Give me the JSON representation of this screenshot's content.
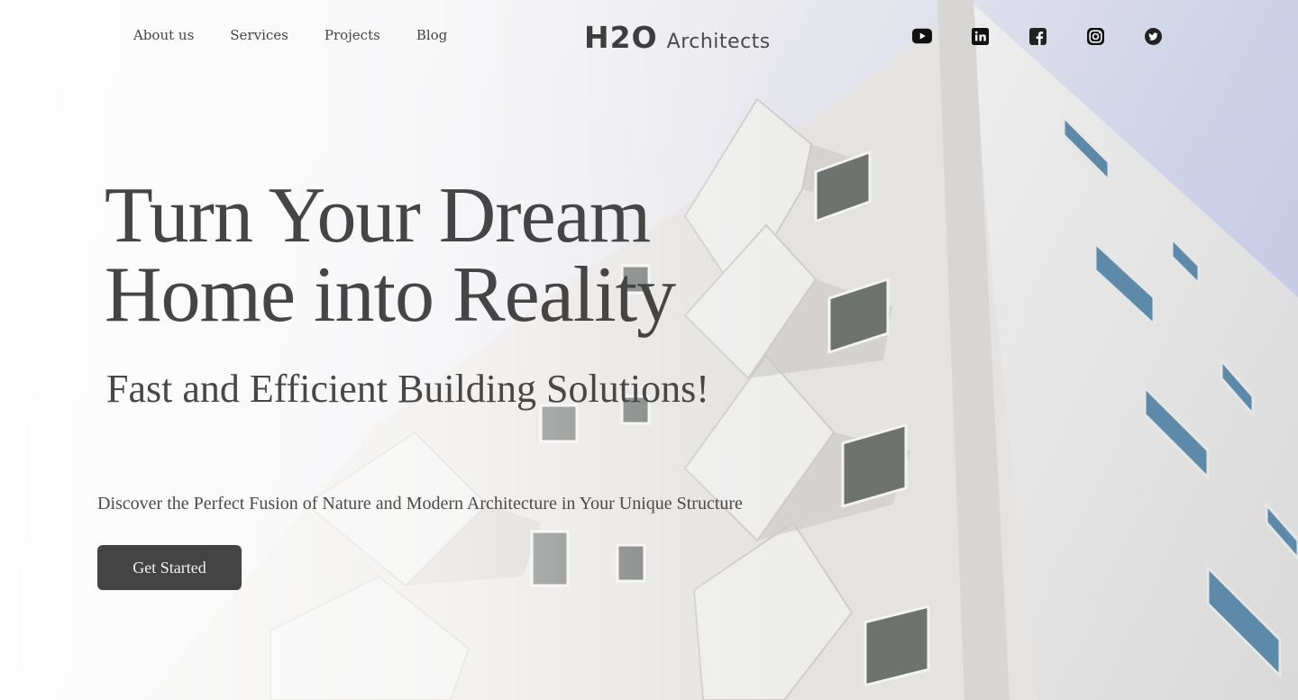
{
  "nav": {
    "items": [
      {
        "label": "About us"
      },
      {
        "label": "Services"
      },
      {
        "label": "Projects"
      },
      {
        "label": "Blog"
      }
    ]
  },
  "logo": {
    "mark": "H2O",
    "word": "Architects"
  },
  "social": [
    {
      "name": "youtube-icon"
    },
    {
      "name": "linkedin-icon"
    },
    {
      "name": "facebook-icon"
    },
    {
      "name": "instagram-icon"
    },
    {
      "name": "twitter-icon"
    }
  ],
  "hero": {
    "headline_line1": "Turn Your Dream",
    "headline_line2": "Home into Reality",
    "subhead": "Fast and Efficient Building Solutions!",
    "tagline": "Discover the Perfect Fusion of Nature and Modern Architecture in Your Unique Structure",
    "cta_label": "Get Started"
  },
  "colors": {
    "text": "#444444",
    "button_bg": "#444444",
    "button_text": "#f2f2f2",
    "sky": "#c9cde8",
    "building": "#e6e4e2"
  }
}
